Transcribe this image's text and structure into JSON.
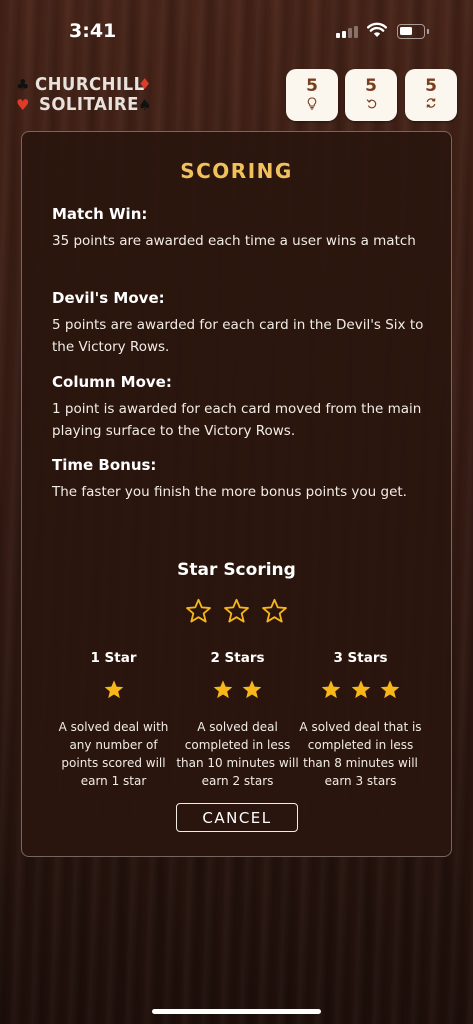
{
  "status_bar": {
    "time": "3:41"
  },
  "logo": {
    "line1": "CHURCHILL",
    "line2": "SOLITAIRE",
    "suits": [
      "club-icon",
      "heart-icon",
      "diamond-icon",
      "spade-icon"
    ]
  },
  "counters": [
    {
      "value": "5",
      "icon": "lightbulb-icon"
    },
    {
      "value": "5",
      "icon": "undo-icon"
    },
    {
      "value": "5",
      "icon": "reshuffle-icon"
    }
  ],
  "modal": {
    "title": "SCORING",
    "rules": [
      {
        "heading": "Match Win:",
        "text": "35 points are awarded each time a user wins a match"
      },
      {
        "heading": "Devil's Move:",
        "text": "5 points are awarded for each card in the Devil's Six to the Victory Rows."
      },
      {
        "heading": "Column Move:",
        "text": "1 point is awarded for each card moved from the main playing surface to the Victory Rows."
      },
      {
        "heading": "Time Bonus:",
        "text": "The faster you finish the more bonus points you get."
      }
    ],
    "star_scoring": {
      "title": "Star Scoring",
      "levels": [
        {
          "label": "1 Star",
          "stars": 1,
          "text": "A solved deal with any number of points scored will earn 1 star"
        },
        {
          "label": "2 Stars",
          "stars": 2,
          "text": "A solved deal completed in less than 10 minutes will earn 2 stars"
        },
        {
          "label": "3 Stars",
          "stars": 3,
          "text": "A solved deal that is completed in less than 8 minutes will earn 3 stars"
        }
      ]
    },
    "cancel_label": "CANCEL"
  },
  "colors": {
    "title_gold": "#f1c15d",
    "star_gold": "#f7b619",
    "counter_text": "#7a3e1d",
    "suit_red": "#e03a2a"
  }
}
